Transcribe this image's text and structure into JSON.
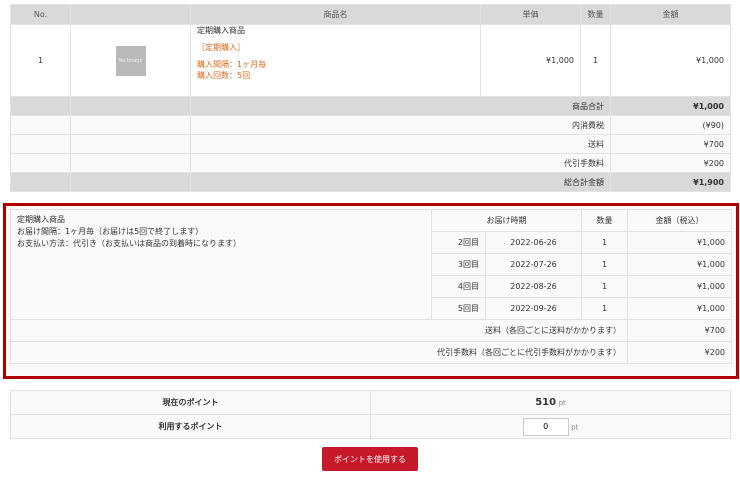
{
  "order": {
    "headers": [
      "No.",
      "",
      "商品名",
      "単価",
      "数量",
      "金額"
    ],
    "item": {
      "no": "1",
      "image_label": "No Image",
      "name": "定期購入商品",
      "tag": "［定期購入］",
      "interval": "購入間隔：1ヶ月毎",
      "count": "購入回数：5回",
      "unit_price": "¥1,000",
      "quantity": "1",
      "amount": "¥1,000"
    },
    "summary": [
      {
        "label": "商品合計",
        "value": "¥1,000"
      },
      {
        "label": "内消費税",
        "value": "(¥90)"
      },
      {
        "label": "送料",
        "value": "¥700"
      },
      {
        "label": "代引手数料",
        "value": "¥200"
      },
      {
        "label": "総合計金額",
        "value": "¥1,900"
      }
    ]
  },
  "subscription": {
    "info": [
      "定期購入商品",
      "お届け間隔：1ヶ月毎（お届けは5回で終了します）",
      "お支払い方法：代引き（お支払いは商品の到着時になります）"
    ],
    "headers": {
      "date": "お届け時期",
      "qty": "数量",
      "amount": "金額（税込）"
    },
    "rows": [
      {
        "round": "2回目",
        "date": "2022-06-26",
        "qty": "1",
        "amount": "¥1,000"
      },
      {
        "round": "3回目",
        "date": "2022-07-26",
        "qty": "1",
        "amount": "¥1,000"
      },
      {
        "round": "4回目",
        "date": "2022-08-26",
        "qty": "1",
        "amount": "¥1,000"
      },
      {
        "round": "5回目",
        "date": "2022-09-26",
        "qty": "1",
        "amount": "¥1,000"
      }
    ],
    "shipping_label": "送料（各回ごとに送料がかかります）",
    "shipping_value": "¥700",
    "cod_label": "代引手数料（各回ごとに代引手数料がかかります）",
    "cod_value": "¥200"
  },
  "points": {
    "current_label": "現在のポイント",
    "current_value": "510",
    "unit": "pt",
    "use_label": "利用するポイント",
    "use_value": "0",
    "button": "ポイントを使用する"
  },
  "colors": {
    "highlight_border": "#b20000",
    "button": "#c8192b",
    "option_text": "#d96b1d"
  }
}
